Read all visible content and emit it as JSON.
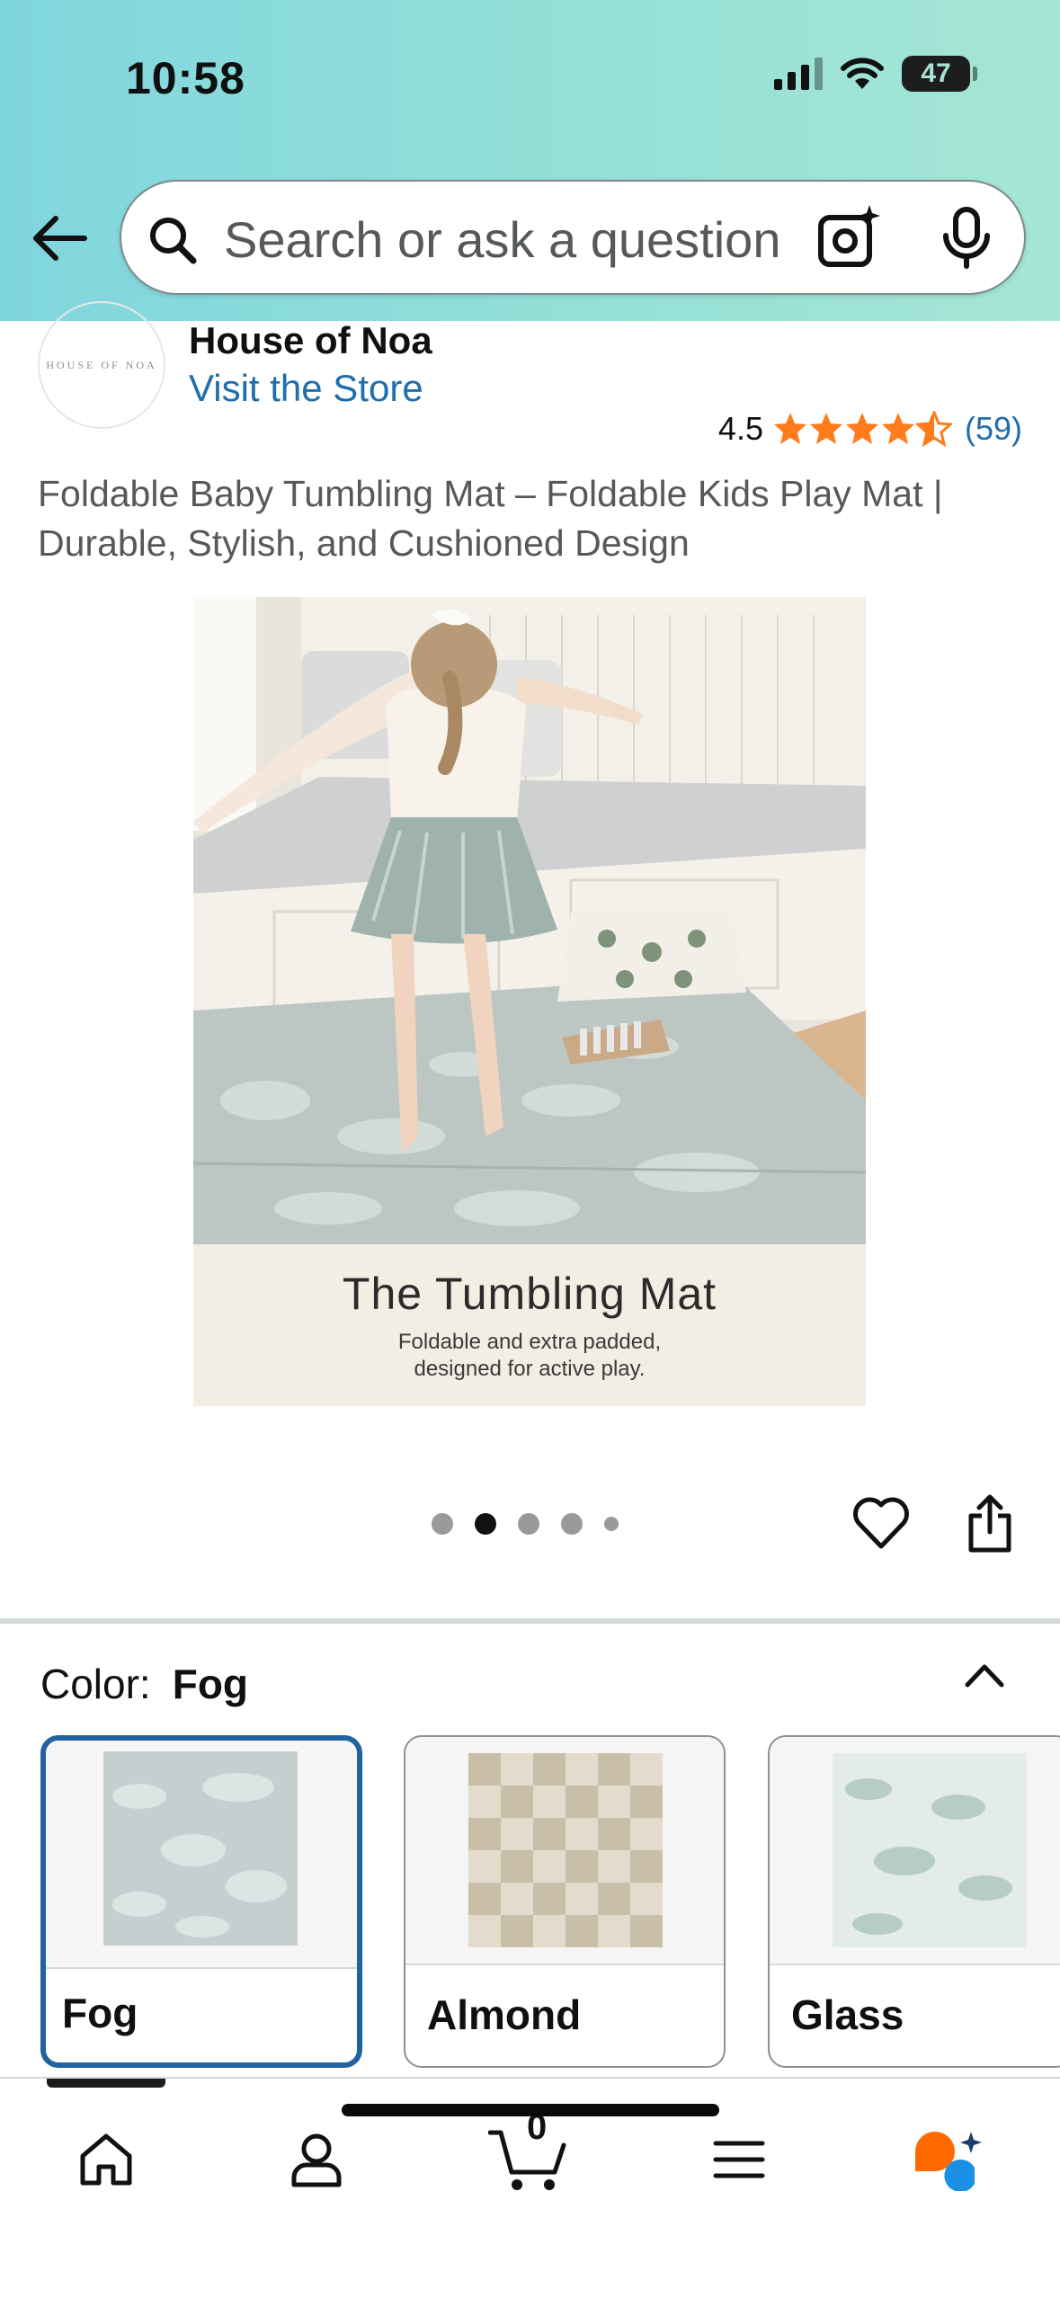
{
  "status_bar": {
    "time": "10:58",
    "battery": "47"
  },
  "search": {
    "placeholder": "Search or ask a question"
  },
  "brand": {
    "logo_text": "HOUSE OF NOA",
    "name": "House of Noa",
    "store_link": "Visit the Store"
  },
  "rating": {
    "value": "4.5",
    "stars": 4.5,
    "count": "(59)",
    "star_color": "#ff7b1b"
  },
  "product": {
    "title": "Foldable Baby Tumbling Mat – Foldable Kids Play Mat | Durable, Stylish, and Cushioned Design",
    "image_caption_title": "The Tumbling Mat",
    "image_caption_sub": "Foldable and extra padded, designed for active play."
  },
  "carousel": {
    "total": 5,
    "active_index": 1
  },
  "color_selector": {
    "label": "Color:",
    "selected": "Fog",
    "swatches": [
      {
        "label": "Fog",
        "selected": true
      },
      {
        "label": "Almond",
        "selected": false
      },
      {
        "label": "Glass",
        "selected": false
      }
    ]
  },
  "bottom_nav": {
    "items": [
      "home-icon",
      "account-icon",
      "cart-icon",
      "menu-icon",
      "rufus-icon"
    ],
    "cart_count": "0"
  },
  "colors": {
    "link": "#1f6ead",
    "selected_border": "#2162a1",
    "header_start": "#80d6de",
    "header_end": "#a6e6d4"
  }
}
